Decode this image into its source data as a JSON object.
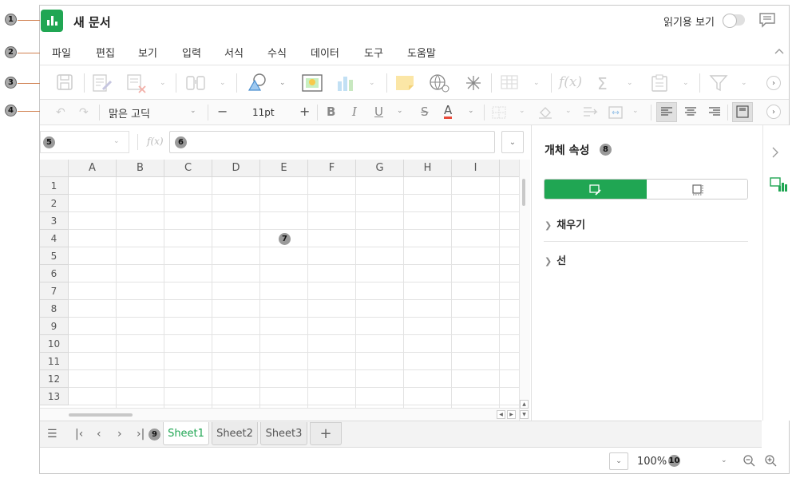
{
  "app": {
    "title": "새 문서",
    "read_mode_label": "읽기용 보기",
    "brand_color": "#20a653"
  },
  "menu": [
    "파일",
    "편집",
    "보기",
    "입력",
    "서식",
    "수식",
    "데이터",
    "도구",
    "도움말"
  ],
  "format_bar": {
    "font_name": "맑은 고딕",
    "font_size": "11pt",
    "minus": "−",
    "plus": "+",
    "bold": "B",
    "italic": "I",
    "underline": "U",
    "strike": "S",
    "font_color": "A"
  },
  "formula_bar": {
    "fx_label": "f(x)",
    "name_box": "",
    "formula": ""
  },
  "sheet": {
    "columns": [
      "A",
      "B",
      "C",
      "D",
      "E",
      "F",
      "G",
      "H",
      "I"
    ],
    "rows": [
      "1",
      "2",
      "3",
      "4",
      "5",
      "6",
      "7",
      "8",
      "9",
      "10",
      "11",
      "12",
      "13"
    ]
  },
  "sheet_tabs": {
    "tabs": [
      "Sheet1",
      "Sheet2",
      "Sheet3"
    ],
    "active": "Sheet1",
    "add": "+"
  },
  "status": {
    "zoom": "100%"
  },
  "panel": {
    "title": "개체 속성",
    "sections": [
      "채우기",
      "선"
    ]
  },
  "callouts": [
    "1",
    "2",
    "3",
    "4",
    "5",
    "6",
    "7",
    "8",
    "9",
    "10"
  ]
}
